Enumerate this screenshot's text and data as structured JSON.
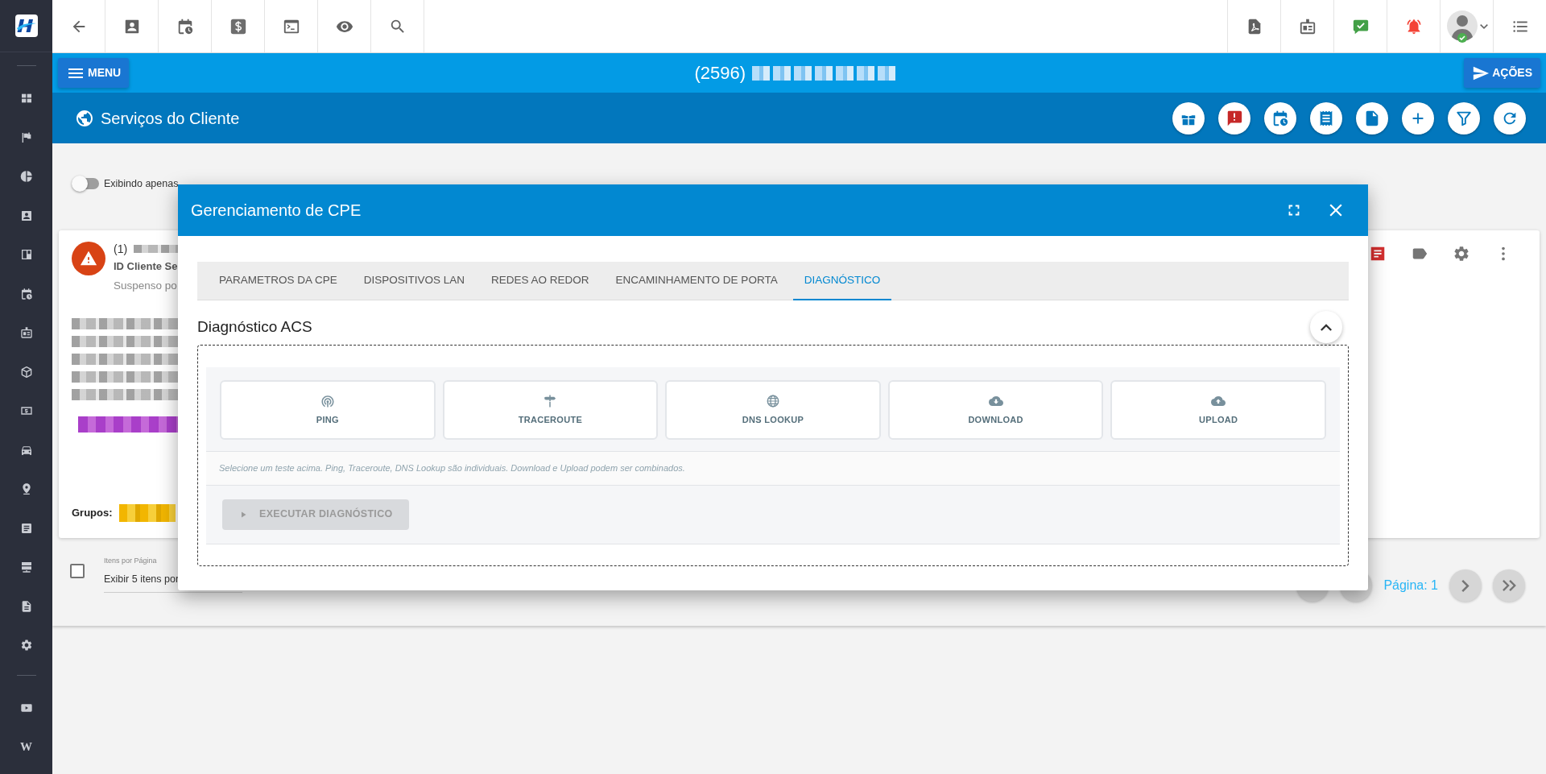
{
  "sidebar": {
    "footer_glyph": "W"
  },
  "header": {
    "menu_button": "MENU",
    "client_title": "(2596)",
    "actions_button": "AÇÕES"
  },
  "page_header": {
    "title": "Serviços do Cliente"
  },
  "filter": {
    "toggle_label": "Exibindo apenas",
    "toggle_on": false
  },
  "client_card": {
    "number": "(1)",
    "id_label": "ID Cliente Se",
    "status": "Suspenso po",
    "groups_label": "Grupos:"
  },
  "pagination": {
    "select_all_checked": false,
    "per_page_label": "Itens por Página",
    "per_page_value": "Exibir 5 itens por",
    "page_label": "Página: 1"
  },
  "modal": {
    "title": "Gerenciamento de CPE",
    "tabs": [
      {
        "label": "PARAMETROS DA CPE",
        "selected": false
      },
      {
        "label": "DISPOSITIVOS LAN",
        "selected": false
      },
      {
        "label": "REDES AO REDOR",
        "selected": false
      },
      {
        "label": "ENCAMINHAMENTO DE PORTA",
        "selected": false
      },
      {
        "label": "DIAGNÓSTICO",
        "selected": true
      }
    ],
    "section": {
      "title": "Diagnóstico ACS",
      "expanded": true,
      "tests": [
        {
          "label": "PING",
          "kind": "ping",
          "selected": false
        },
        {
          "label": "TRACEROUTE",
          "kind": "traceroute",
          "selected": false
        },
        {
          "label": "DNS LOOKUP",
          "kind": "dns",
          "selected": false
        },
        {
          "label": "DOWNLOAD",
          "kind": "download",
          "selected": false
        },
        {
          "label": "UPLOAD",
          "kind": "upload",
          "selected": false
        }
      ],
      "hint": "Selecione um teste acima. Ping, Traceroute, DNS Lookup são individuais. Download e Upload podem ser combinados.",
      "run_button": {
        "label": "EXECUTAR DIAGNÓSTICO",
        "disabled": true
      }
    }
  }
}
